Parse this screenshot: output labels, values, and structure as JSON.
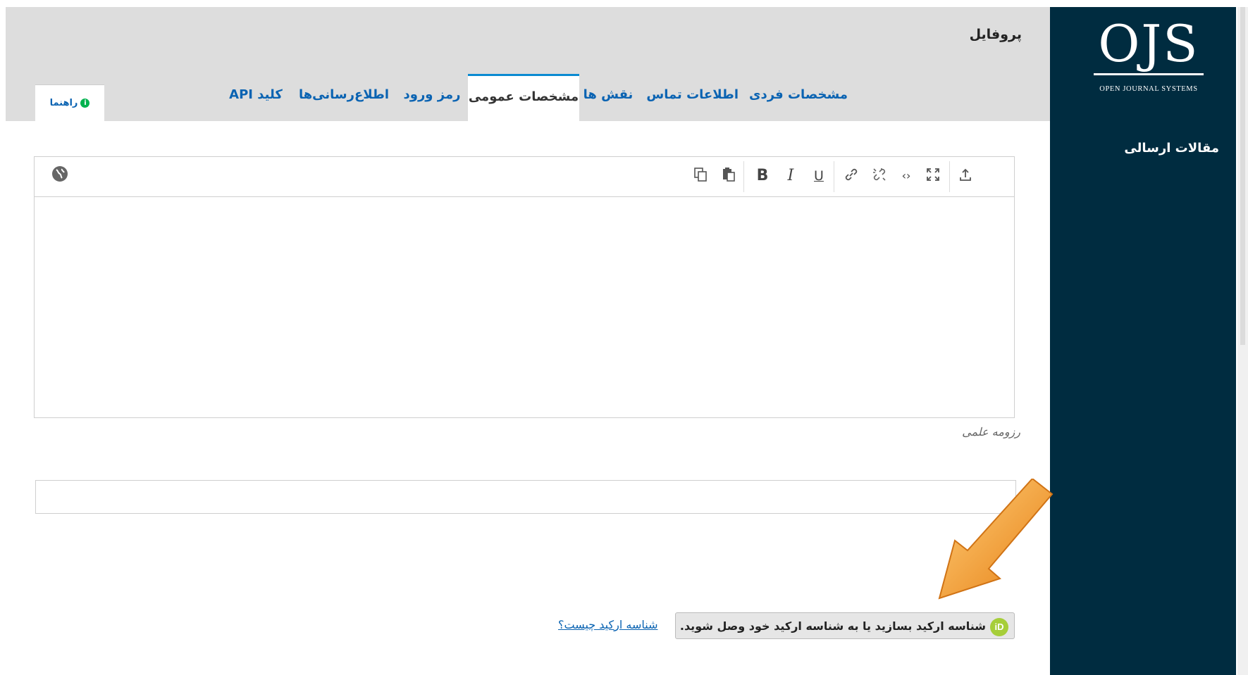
{
  "sidebar": {
    "logo": {
      "letters": "OJS",
      "subtitle": "OPEN JOURNAL SYSTEMS"
    },
    "nav": [
      {
        "label": "مقالات ارسالی"
      }
    ]
  },
  "header": {
    "title": "پروفایل",
    "tabs": [
      {
        "label": "مشخصات فردی"
      },
      {
        "label": "اطلاعات تماس"
      },
      {
        "label": "نقش ها"
      },
      {
        "label": "مشخصات عمومی",
        "active": true
      },
      {
        "label": "رمز ورود"
      },
      {
        "label": "اطلاع‌رسانی‌ها"
      },
      {
        "label": "کلید API"
      }
    ],
    "help": {
      "label": "راهنما",
      "icon": "info-icon"
    }
  },
  "editor": {
    "toolbar": {
      "copy": "copy-icon",
      "paste": "paste-icon",
      "bold": "B",
      "italic": "I",
      "underline": "U",
      "link": "link-icon",
      "unlink": "unlink-icon",
      "code": "code-icon",
      "fullscreen": "fullscreen-icon",
      "upload": "upload-icon",
      "language": "globe-icon"
    },
    "label": "رزومه علمی",
    "value": ""
  },
  "url_input": {
    "value": ""
  },
  "orcid": {
    "icon_text": "iD",
    "button_label": "شناسه ارکید بسازید یا به شناسه ارکید خود وصل شوید.",
    "help_link": "شناسه ارکید چیست؟"
  },
  "colors": {
    "sidebar": "#002c40",
    "header": "#dddddd",
    "link": "#0a63b2",
    "active_tab_border": "#0a8ad1",
    "orcid": "#a6ce39",
    "arrow": "#f59a23"
  }
}
